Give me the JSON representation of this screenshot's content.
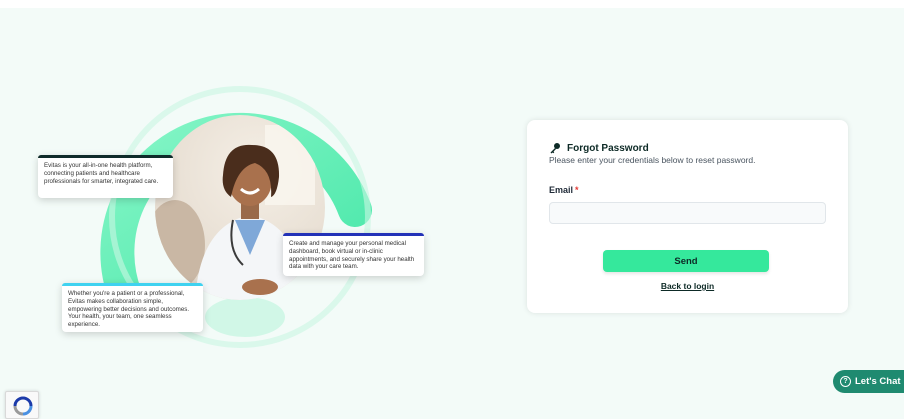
{
  "hero": {
    "card_platform": "Evitas is your all-in-one health platform, connecting patients and healthcare professionals for smarter, integrated care.",
    "card_manage": "Create and manage your personal medical dashboard, book virtual or in-clinic appointments, and securely share your health data with your care team.",
    "card_collab": "Whether you're a patient or a professional, Evitas makes collaboration simple, empowering better decisions and outcomes. Your health, your team, one seamless experience."
  },
  "form": {
    "title": "Forgot Password",
    "subtitle": "Please enter your credentials below to reset password.",
    "email_label": "Email",
    "email_required_mark": "*",
    "email_value": "",
    "email_placeholder": "",
    "send_label": "Send",
    "back_label": "Back to login"
  },
  "chat": {
    "label": "Let's Chat",
    "icon": "question-circle-icon"
  },
  "colors": {
    "background": "#f3fbf8",
    "accent": "#35e89c",
    "ring": "#5ef0b4",
    "chat": "#1f8a70",
    "required": "#e53935"
  }
}
